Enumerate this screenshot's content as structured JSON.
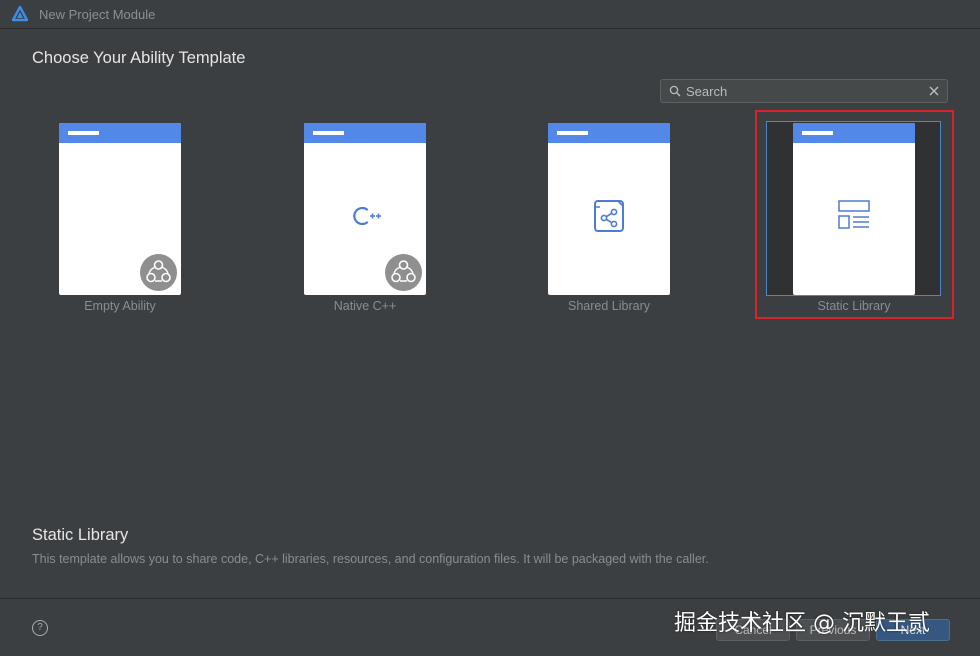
{
  "window": {
    "title": "New Project Module"
  },
  "page": {
    "title": "Choose Your Ability Template"
  },
  "search": {
    "placeholder": "Search"
  },
  "templates": [
    {
      "label": "Empty Ability",
      "icon": "ability-badge-icon",
      "selected": false
    },
    {
      "label": "Native C++",
      "icon": "cpp-icon",
      "selected": false
    },
    {
      "label": "Shared Library",
      "icon": "shared-library-icon",
      "selected": false
    },
    {
      "label": "Static Library",
      "icon": "static-library-icon",
      "selected": true
    }
  ],
  "description": {
    "title": "Static Library",
    "text": "This template allows you to share code, C++ libraries, resources, and configuration files. It will be packaged with the caller."
  },
  "footer": {
    "help_label": "?",
    "buttons": [
      "Cancel",
      "Previous",
      "Next"
    ],
    "watermark": "掘金技术社区 @ 沉默王贰"
  },
  "colors": {
    "background": "#3c3f41",
    "card_header": "#5288e8",
    "selection_border": "#4a88c7",
    "highlight": "#d9232a",
    "icon_blue": "#4d7bd6"
  }
}
